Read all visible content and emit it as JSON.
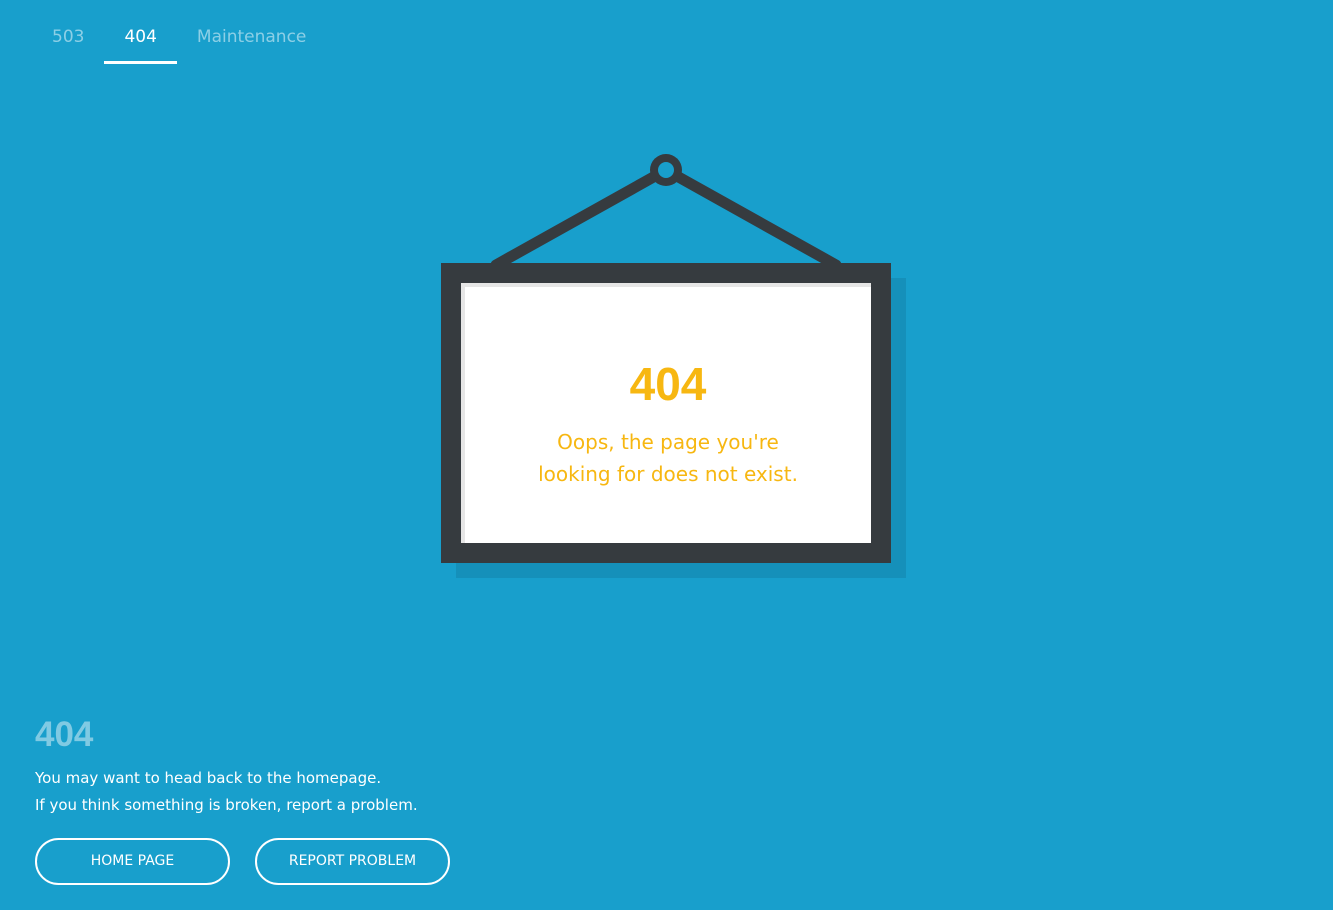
{
  "tabs": [
    {
      "label": "503",
      "active": false
    },
    {
      "label": "404",
      "active": true
    },
    {
      "label": "Maintenance",
      "active": false
    }
  ],
  "sign": {
    "code": "404",
    "message_line1": "Oops, the page you're",
    "message_line2": "looking for does not exist."
  },
  "info": {
    "title": "404",
    "line1": "You may want to head back to the homepage.",
    "line2": "If you think something is broken, report a problem."
  },
  "buttons": {
    "home_label": "HOME PAGE",
    "report_label": "REPORT PROBLEM"
  },
  "colors": {
    "background": "#189fcc",
    "frame": "#363b3f",
    "accent": "#f7b711",
    "shadow": "#1590ba"
  }
}
